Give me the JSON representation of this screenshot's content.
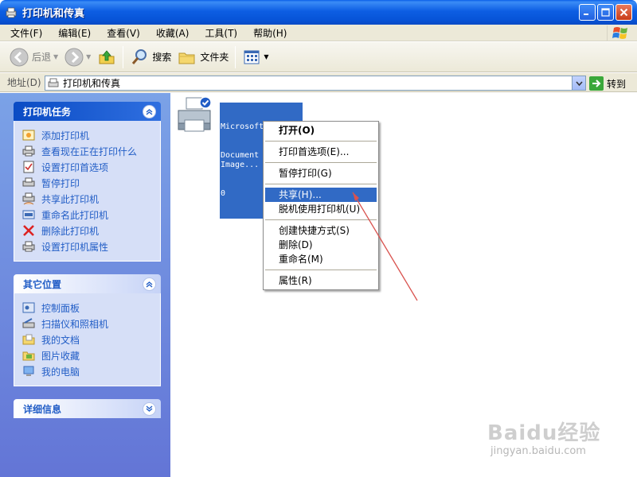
{
  "window": {
    "title": "打印机和传真",
    "buttons": [
      "minimize",
      "maximize",
      "close"
    ]
  },
  "menubar": {
    "items": [
      "文件(F)",
      "编辑(E)",
      "查看(V)",
      "收藏(A)",
      "工具(T)",
      "帮助(H)"
    ]
  },
  "toolbar": {
    "back_label": "后退",
    "search_label": "搜索",
    "folders_label": "文件夹"
  },
  "address": {
    "label": "地址(D)",
    "value": "打印机和传真",
    "go_label": "转到"
  },
  "taskpane": {
    "printer_tasks": {
      "title": "打印机任务",
      "items": [
        {
          "label": "添加打印机",
          "icon": "add-printer-icon"
        },
        {
          "label": "查看现在正在打印什么",
          "icon": "print-queue-icon"
        },
        {
          "label": "设置打印首选项",
          "icon": "preferences-icon"
        },
        {
          "label": "暂停打印",
          "icon": "pause-printer-icon"
        },
        {
          "label": "共享此打印机",
          "icon": "share-printer-icon"
        },
        {
          "label": "重命名此打印机",
          "icon": "rename-icon"
        },
        {
          "label": "删除此打印机",
          "icon": "delete-icon"
        },
        {
          "label": "设置打印机属性",
          "icon": "properties-icon"
        }
      ]
    },
    "other_places": {
      "title": "其它位置",
      "items": [
        {
          "label": "控制面板",
          "icon": "control-panel-icon"
        },
        {
          "label": "扫描仪和照相机",
          "icon": "scanner-icon"
        },
        {
          "label": "我的文档",
          "icon": "my-documents-icon"
        },
        {
          "label": "图片收藏",
          "icon": "my-pictures-icon"
        },
        {
          "label": "我的电脑",
          "icon": "my-computer-icon"
        }
      ]
    },
    "details": {
      "title": "详细信息"
    }
  },
  "content": {
    "printer_name_lines": [
      "Microsoft Office",
      "Document Image...",
      "0"
    ]
  },
  "context_menu": {
    "items": [
      {
        "label": "打开(O)",
        "bold": true
      },
      {
        "label": "打印首选项(E)..."
      },
      {
        "label": "暂停打印(G)"
      },
      {
        "label": "共享(H)...",
        "highlighted": true
      },
      {
        "label": "脱机使用打印机(U)"
      },
      {
        "label": "创建快捷方式(S)"
      },
      {
        "label": "删除(D)"
      },
      {
        "label": "重命名(M)"
      },
      {
        "label": "属性(R)"
      }
    ]
  },
  "watermark": {
    "main": "Baidu经验",
    "sub": "jingyan.baidu.com"
  },
  "colors": {
    "selection": "#316ac5",
    "task_link": "#215dc6",
    "annotation_arrow": "#d9534f"
  }
}
